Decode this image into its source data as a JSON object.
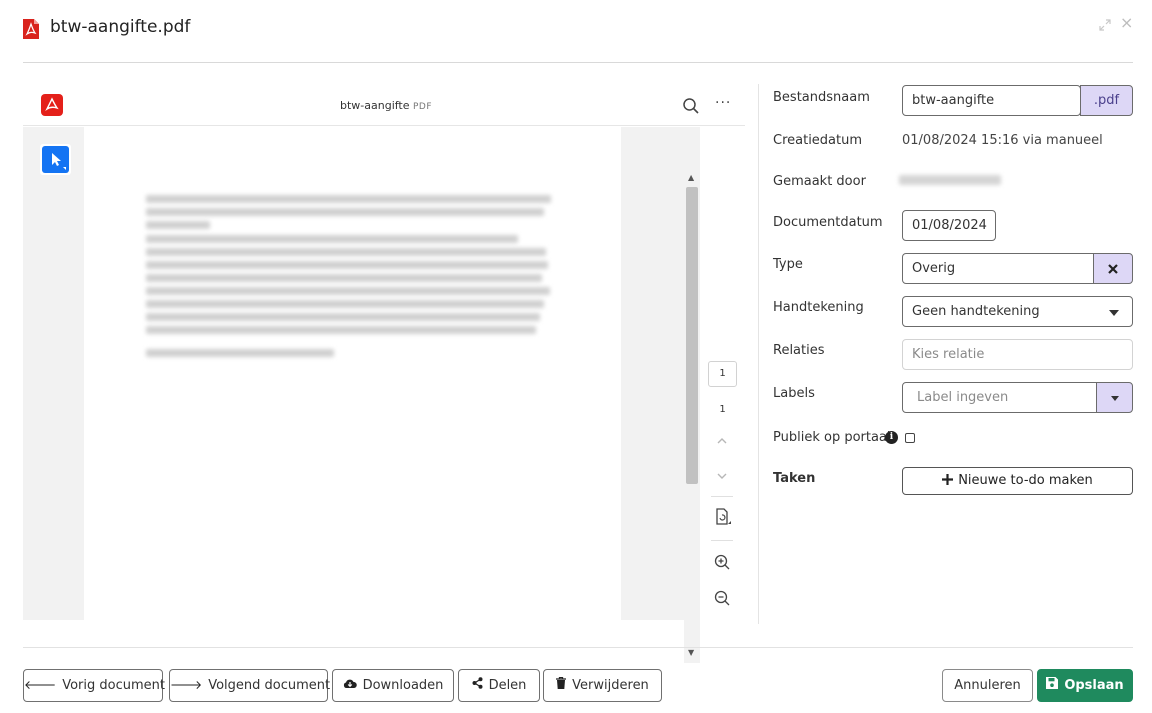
{
  "header": {
    "title": "btw-aangifte.pdf",
    "expand_icon": "expand-icon",
    "close_glyph": "×"
  },
  "viewer": {
    "doc_name": "btw-aangifte",
    "doc_ext": "PDF",
    "more_glyph": "···",
    "current_page": "1",
    "total_pages": "1",
    "accent_color": "#1474f3",
    "brand_color": "#e4201a"
  },
  "form": {
    "filename_label": "Bestandsnaam",
    "filename_value": "btw-aangifte",
    "filename_ext": ".pdf",
    "created_label": "Creatiedatum",
    "created_value": "01/08/2024 15:16 via manueel",
    "made_by_label": "Gemaakt door",
    "docdate_label": "Documentdatum",
    "docdate_value": "01/08/2024",
    "type_label": "Type",
    "type_value": "Overig",
    "signature_label": "Handtekening",
    "signature_value": "Geen handtekening",
    "relations_label": "Relaties",
    "relations_placeholder": "Kies relatie",
    "labels_label": "Labels",
    "labels_placeholder": "Label ingeven",
    "public_label": "Publiek op portaal",
    "tasks_label": "Taken",
    "new_todo_label": "Nieuwe to-do maken"
  },
  "footer": {
    "prev_label": "Vorig document",
    "next_label": "Volgend document",
    "download_label": "Downloaden",
    "share_label": "Delen",
    "delete_label": "Verwijderen",
    "cancel_label": "Annuleren",
    "save_label": "Opslaan",
    "save_color": "#1f8a5e"
  }
}
